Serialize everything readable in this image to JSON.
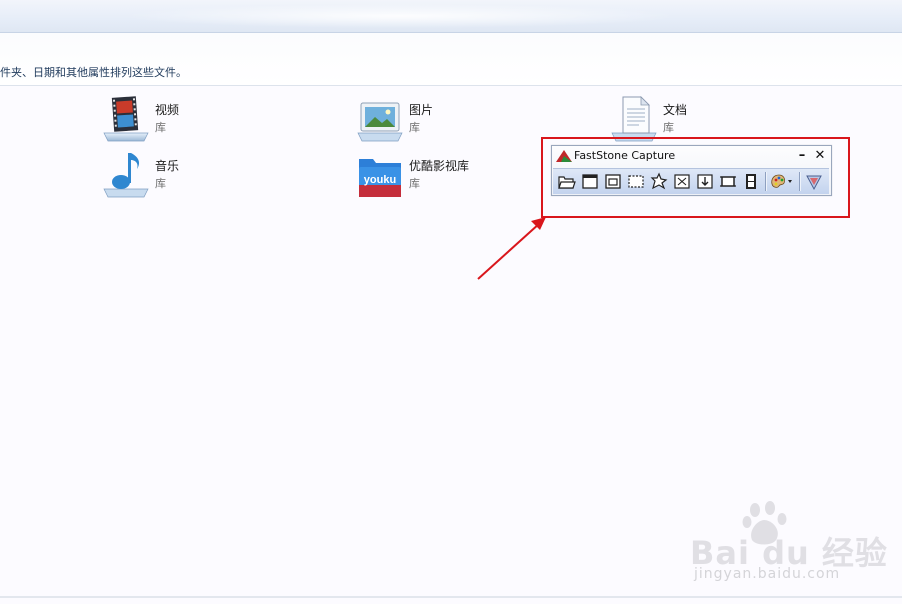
{
  "explorer": {
    "hint": "件夹、日期和其他属性排列这些文件。",
    "libraries": [
      {
        "name": "视频",
        "type": "库",
        "icon": "video-library-icon"
      },
      {
        "name": "图片",
        "type": "库",
        "icon": "picture-library-icon"
      },
      {
        "name": "文档",
        "type": "库",
        "icon": "document-library-icon"
      },
      {
        "name": "音乐",
        "type": "库",
        "icon": "music-library-icon"
      },
      {
        "name": "优酷影视库",
        "type": "库",
        "icon": "youku-library-icon"
      }
    ],
    "youku_logo_text": "youku"
  },
  "faststone": {
    "title": "FastStone Capture",
    "minimize_label": "–",
    "close_label": "✕",
    "tools": [
      "open-file-icon",
      "capture-active-window-icon",
      "capture-window-object-icon",
      "capture-rectangle-icon",
      "capture-freehand-icon",
      "capture-fullscreen-icon",
      "capture-scrolling-window-icon",
      "capture-fixed-region-icon",
      "screen-recorder-icon",
      "output-palette-icon",
      "settings-icon"
    ]
  },
  "annotation": {
    "frame_color": "#d9161c",
    "arrow_color": "#d9161c"
  },
  "watermark": {
    "logo_text": "Bai du 经验",
    "url": "jingyan.baidu.com"
  }
}
